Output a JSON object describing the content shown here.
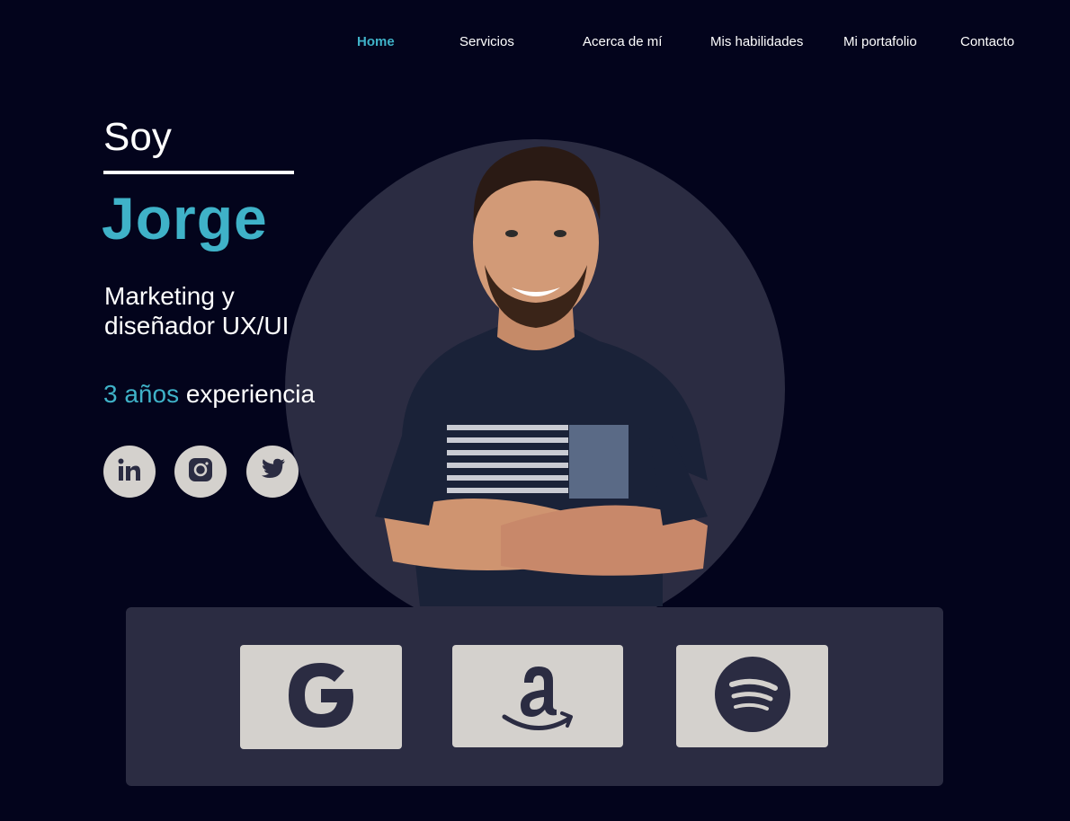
{
  "nav": {
    "items": [
      {
        "label": "Home",
        "active": true
      },
      {
        "label": "Servicios",
        "active": false
      },
      {
        "label": "Acerca de mí",
        "active": false
      },
      {
        "label": "Mis habilidades",
        "active": false
      },
      {
        "label": "Mi portafolio",
        "active": false
      },
      {
        "label": "Contacto",
        "active": false
      }
    ]
  },
  "hero": {
    "intro": "Soy",
    "name": "Jorge",
    "role": "Marketing y diseñador UX/UI",
    "experience_highlight": "3 años",
    "experience_rest": "experiencia"
  },
  "social": [
    {
      "icon": "linkedin-icon"
    },
    {
      "icon": "instagram-icon"
    },
    {
      "icon": "twitter-icon"
    }
  ],
  "brands": [
    {
      "icon": "google-icon"
    },
    {
      "icon": "amazon-icon"
    },
    {
      "icon": "spotify-icon"
    }
  ],
  "colors": {
    "background": "#03041c",
    "accent": "#3fb2c8",
    "panel": "#2b2c42",
    "tile": "#d4d1cd"
  }
}
